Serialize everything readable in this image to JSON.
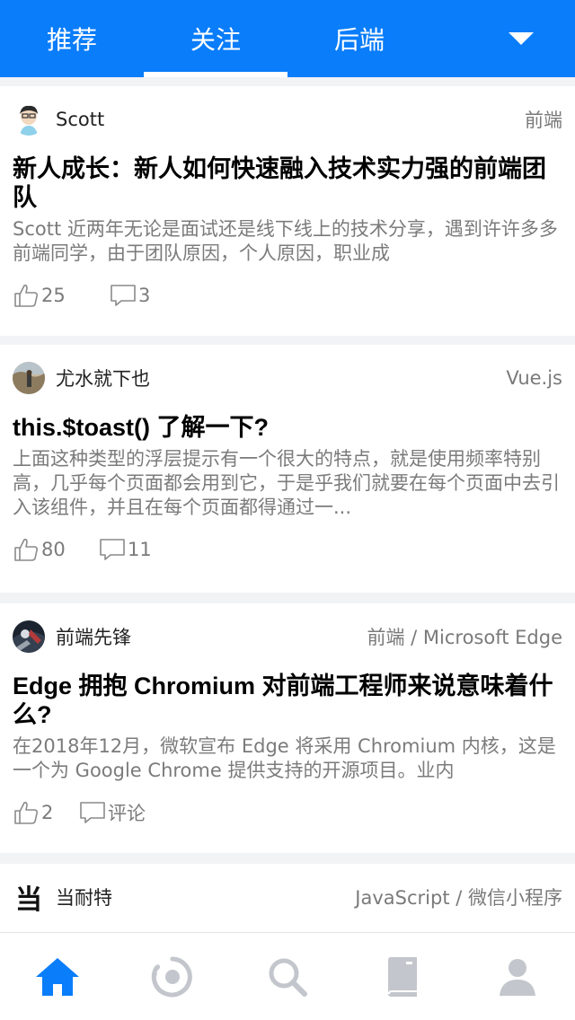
{
  "topbar": {
    "tabs": [
      {
        "label": "推荐"
      },
      {
        "label": "关注"
      },
      {
        "label": "后端"
      }
    ],
    "active_tab": 1,
    "more_icon": "caret-down-icon"
  },
  "feed": {
    "articles": [
      {
        "author": "Scott",
        "tags": "前端",
        "title": "新人成长：新人如何快速融入技术实力强的前端团队",
        "excerpt": "Scott 近两年无论是面试还是线下线上的技术分享，遇到许许多多前端同学，由于团队原因，个人原因，职业成",
        "likes": "25",
        "comments": "3"
      },
      {
        "author": "尤水就下也",
        "tags": "Vue.js",
        "title": "this.$toast() 了解一下?",
        "excerpt": "上面这种类型的浮层提示有一个很大的特点，就是使用频率特别高，几乎每个页面都会用到它，于是乎我们就要在每个页面中去引入该组件，并且在每个页面都得通过一...",
        "likes": "80",
        "comments": "11"
      },
      {
        "author": "前端先锋",
        "tags": "前端 / Microsoft Edge",
        "title": "Edge 拥抱 Chromium 对前端工程师来说意味着什么?",
        "excerpt": "在2018年12月，微软宣布 Edge 将采用 Chromium 内核，这是一个为 Google Chrome 提供支持的开源项目。业内",
        "likes": "2",
        "comments": "评论"
      },
      {
        "author": "当耐特",
        "avatar_glyph": "当",
        "tags": "JavaScript / 微信小程序"
      }
    ]
  },
  "bottomnav": {
    "items": [
      {
        "icon": "home-icon",
        "active": true
      },
      {
        "icon": "activity-ring-icon",
        "active": false
      },
      {
        "icon": "search-icon",
        "active": false
      },
      {
        "icon": "book-icon",
        "active": false
      },
      {
        "icon": "user-icon",
        "active": false
      }
    ]
  },
  "colors": {
    "brand": "#0a7dfa",
    "inactive_icon": "#c3c6cc",
    "muted_text": "#7b7b7b"
  }
}
